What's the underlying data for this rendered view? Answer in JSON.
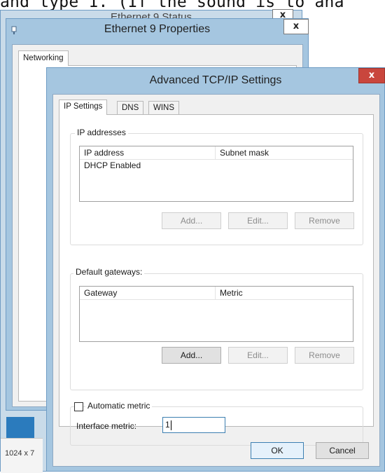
{
  "background_text": "and type 1. (If the sound is to ana",
  "windows": {
    "status": {
      "title": "Ethernet 9 Status",
      "close": "x",
      "footer_text": "1024 x 7"
    },
    "properties": {
      "title": "Ethernet 9 Properties",
      "close": "x",
      "tab": "Networking"
    },
    "advanced": {
      "title": "Advanced TCP/IP Settings",
      "close": "x",
      "tabs": [
        "IP Settings",
        "DNS",
        "WINS"
      ],
      "ip_addresses": {
        "label": "IP addresses",
        "columns": [
          "IP address",
          "Subnet mask"
        ],
        "rows": [
          "DHCP Enabled"
        ],
        "buttons": [
          "Add...",
          "Edit...",
          "Remove"
        ]
      },
      "default_gateways": {
        "label": "Default gateways:",
        "columns": [
          "Gateway",
          "Metric"
        ],
        "buttons": [
          "Add...",
          "Edit...",
          "Remove"
        ]
      },
      "automatic_metric": {
        "label": "Automatic metric",
        "checked": false
      },
      "interface_metric": {
        "label": "Interface metric:",
        "value": "1"
      },
      "ok": "OK",
      "cancel": "Cancel"
    }
  },
  "colors": {
    "window_frame": "#a5c6e0",
    "close_button_red": "#c9463d",
    "dialog_bg": "#f0f0f0"
  }
}
